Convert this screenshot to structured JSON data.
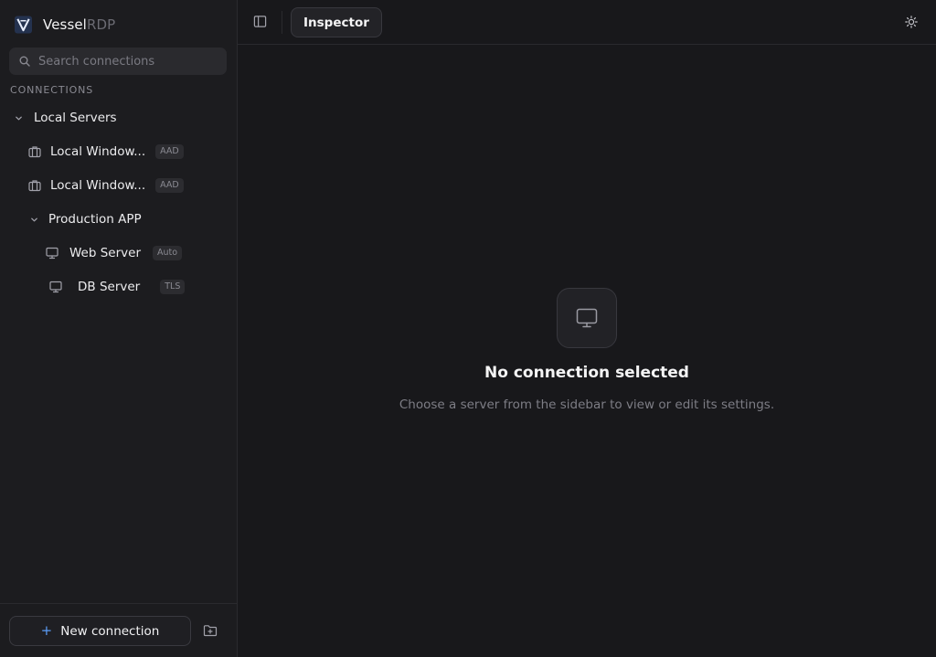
{
  "brand": {
    "name": "Vessel",
    "suffix": "RDP"
  },
  "search": {
    "placeholder": "Search connections",
    "value": ""
  },
  "sidebar": {
    "section_label": "CONNECTIONS",
    "groups": [
      {
        "label": "Local Servers",
        "expanded": true,
        "items": [
          {
            "label": "Local Window...",
            "badge": "AAD",
            "icon": "briefcase-icon"
          },
          {
            "label": "Local Window...",
            "badge": "AAD",
            "icon": "briefcase-icon"
          }
        ],
        "subgroups": [
          {
            "label": "Production APP",
            "expanded": true,
            "items": [
              {
                "label": "Web Server",
                "badge": "Auto",
                "icon": "monitor-icon"
              },
              {
                "label": "DB Server",
                "badge": "TLS",
                "icon": "monitor-icon"
              }
            ]
          }
        ]
      }
    ],
    "new_connection_label": "New connection",
    "new_connection_icon": "plus-icon",
    "new_folder_icon": "folder-plus-icon"
  },
  "topbar": {
    "tab_label": "Inspector",
    "panel_toggle_icon": "sidebar-toggle-icon",
    "theme_icon": "sun-icon"
  },
  "empty_state": {
    "icon": "monitor-icon",
    "title": "No connection selected",
    "description": "Choose a server from the sidebar to view or edit its settings."
  },
  "colors": {
    "background": "#18181b",
    "sidebar": "#1c1c1f",
    "accent": "#5b9cf6",
    "logo": "#3b6fd6"
  }
}
